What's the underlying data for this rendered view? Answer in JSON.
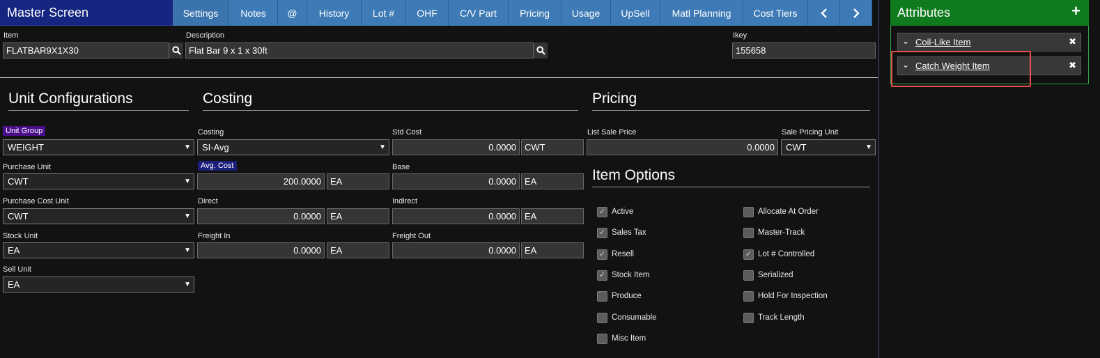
{
  "title": "Master Screen",
  "tabs": [
    "Settings",
    "Notes",
    "@",
    "History",
    "Lot #",
    "OHF",
    "C/V Part",
    "Pricing",
    "Usage",
    "UpSell",
    "Matl Planning",
    "Cost Tiers"
  ],
  "item": {
    "label": "Item",
    "value": "FLATBAR9X1X30"
  },
  "description": {
    "label": "Description",
    "value": "Flat Bar 9 x 1 x 30ft"
  },
  "ikey": {
    "label": "Ikey",
    "value": "155658"
  },
  "sections": {
    "unit": "Unit Configurations",
    "costing": "Costing",
    "pricing": "Pricing",
    "options": "Item Options"
  },
  "unit": {
    "unit_group": {
      "label": "Unit Group",
      "value": "WEIGHT"
    },
    "purchase_unit": {
      "label": "Purchase Unit",
      "value": "CWT"
    },
    "purchase_cost_unit": {
      "label": "Purchase Cost Unit",
      "value": "CWT"
    },
    "stock_unit": {
      "label": "Stock Unit",
      "value": "EA"
    },
    "sell_unit": {
      "label": "Sell Unit",
      "value": "EA"
    }
  },
  "costing": {
    "costing": {
      "label": "Costing",
      "value": "SI-Avg"
    },
    "avg_cost": {
      "label": "Avg. Cost",
      "value": "200.0000",
      "unit": "EA"
    },
    "direct": {
      "label": "Direct",
      "value": "0.0000",
      "unit": "EA"
    },
    "freight_in": {
      "label": "Freight In",
      "value": "0.0000",
      "unit": "EA"
    },
    "std_cost": {
      "label": "Std Cost",
      "value": "0.0000",
      "unit": "CWT"
    },
    "base": {
      "label": "Base",
      "value": "0.0000",
      "unit": "EA"
    },
    "indirect": {
      "label": "Indirect",
      "value": "0.0000",
      "unit": "EA"
    },
    "freight_out": {
      "label": "Freight Out",
      "value": "0.0000",
      "unit": "EA"
    }
  },
  "pricing": {
    "list_sale_price": {
      "label": "List Sale Price",
      "value": "0.0000"
    },
    "sale_pricing_unit": {
      "label": "Sale Pricing Unit",
      "value": "CWT"
    }
  },
  "options_left": [
    {
      "label": "Active",
      "checked": true
    },
    {
      "label": "Sales Tax",
      "checked": true
    },
    {
      "label": "Resell",
      "checked": true
    },
    {
      "label": "Stock Item",
      "checked": true
    },
    {
      "label": "Produce",
      "checked": false
    },
    {
      "label": "Consumable",
      "checked": false
    },
    {
      "label": "Misc Item",
      "checked": false
    }
  ],
  "options_right": [
    {
      "label": "Allocate At Order",
      "checked": false
    },
    {
      "label": "Master-Track",
      "checked": false
    },
    {
      "label": "Lot # Controlled",
      "checked": true
    },
    {
      "label": "Serialized",
      "checked": false
    },
    {
      "label": "Hold For Inspection",
      "checked": false
    },
    {
      "label": "Track Length",
      "checked": false
    }
  ],
  "attributes": {
    "title": "Attributes",
    "items": [
      "Coil-Like Item",
      "Catch Weight Item"
    ]
  },
  "colors": {
    "title_bar": "#152580",
    "tab": "#3d7ab6",
    "attr_header": "#0f7a1e",
    "unit_group_badge": "#4b0e8a",
    "avg_cost_badge": "#1a1f7a",
    "highlight": "#e8524a"
  }
}
